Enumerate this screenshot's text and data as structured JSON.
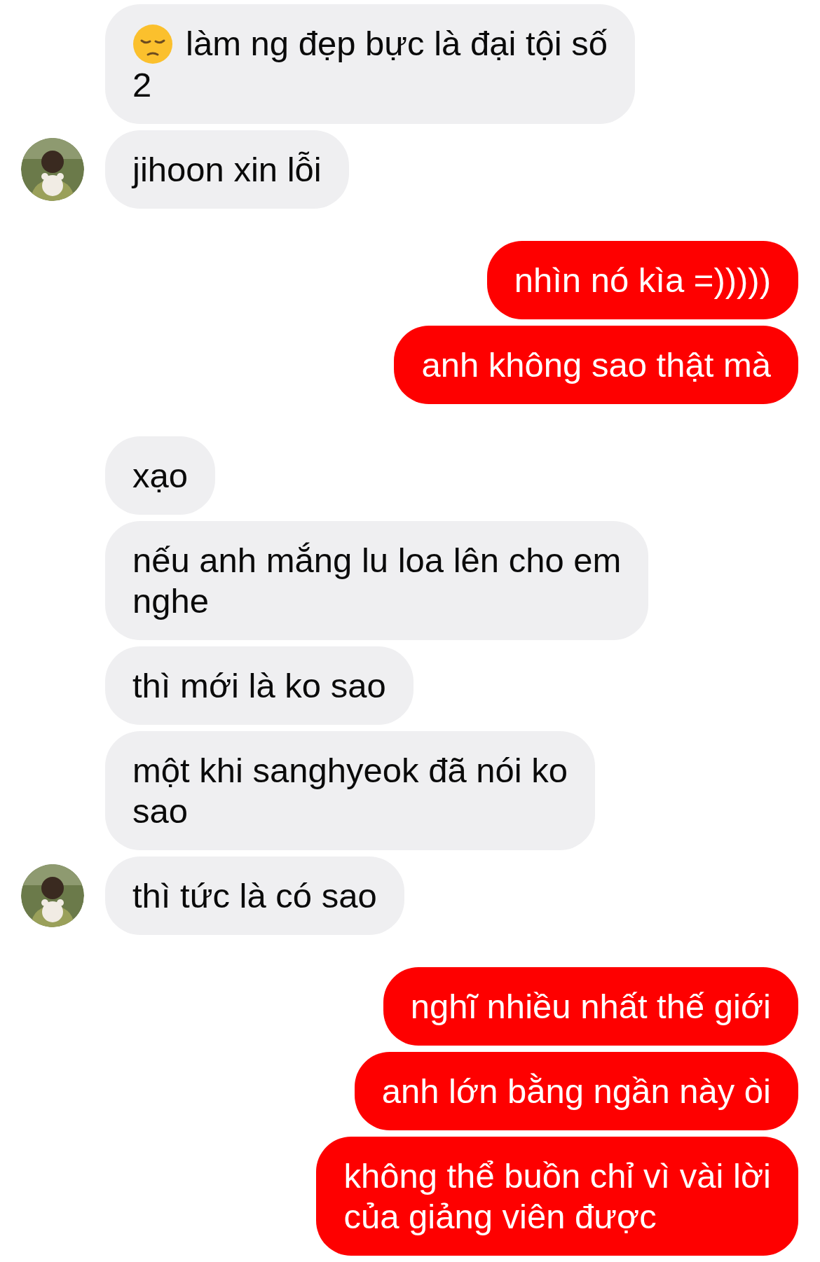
{
  "groups": [
    {
      "messages": [
        {
          "kind": "received",
          "emoji_icon": true,
          "avatar": false,
          "lines": [
            "làm ng đẹp bực là đại tội số",
            "2"
          ]
        },
        {
          "kind": "received",
          "emoji_icon": false,
          "avatar": true,
          "lines": [
            "jihoon xin lỗi"
          ]
        }
      ]
    },
    {
      "messages": [
        {
          "kind": "sent",
          "emoji_icon": false,
          "avatar": false,
          "lines": [
            "nhìn nó kìa =)))))"
          ]
        },
        {
          "kind": "sent",
          "emoji_icon": false,
          "avatar": false,
          "lines": [
            "anh không sao thật mà"
          ]
        }
      ]
    },
    {
      "messages": [
        {
          "kind": "received",
          "emoji_icon": false,
          "avatar": false,
          "lines": [
            "xạo"
          ]
        },
        {
          "kind": "received",
          "emoji_icon": false,
          "avatar": false,
          "lines": [
            "nếu anh mắng lu loa lên cho em",
            "nghe"
          ]
        },
        {
          "kind": "received",
          "emoji_icon": false,
          "avatar": false,
          "lines": [
            "thì mới là ko sao"
          ]
        },
        {
          "kind": "received",
          "emoji_icon": false,
          "avatar": false,
          "lines": [
            "một khi sanghyeok đã nói ko",
            "sao"
          ]
        },
        {
          "kind": "received",
          "emoji_icon": false,
          "avatar": true,
          "lines": [
            "thì tức là có sao"
          ]
        }
      ]
    },
    {
      "messages": [
        {
          "kind": "sent",
          "emoji_icon": false,
          "avatar": false,
          "lines": [
            "nghĩ nhiều nhất thế giới"
          ]
        },
        {
          "kind": "sent",
          "emoji_icon": false,
          "avatar": false,
          "lines": [
            "anh lớn bằng ngần này òi"
          ]
        },
        {
          "kind": "sent",
          "emoji_icon": false,
          "avatar": false,
          "lines": [
            "không thể buồn chỉ vì vài lời",
            "của giảng viên được"
          ]
        }
      ]
    }
  ]
}
